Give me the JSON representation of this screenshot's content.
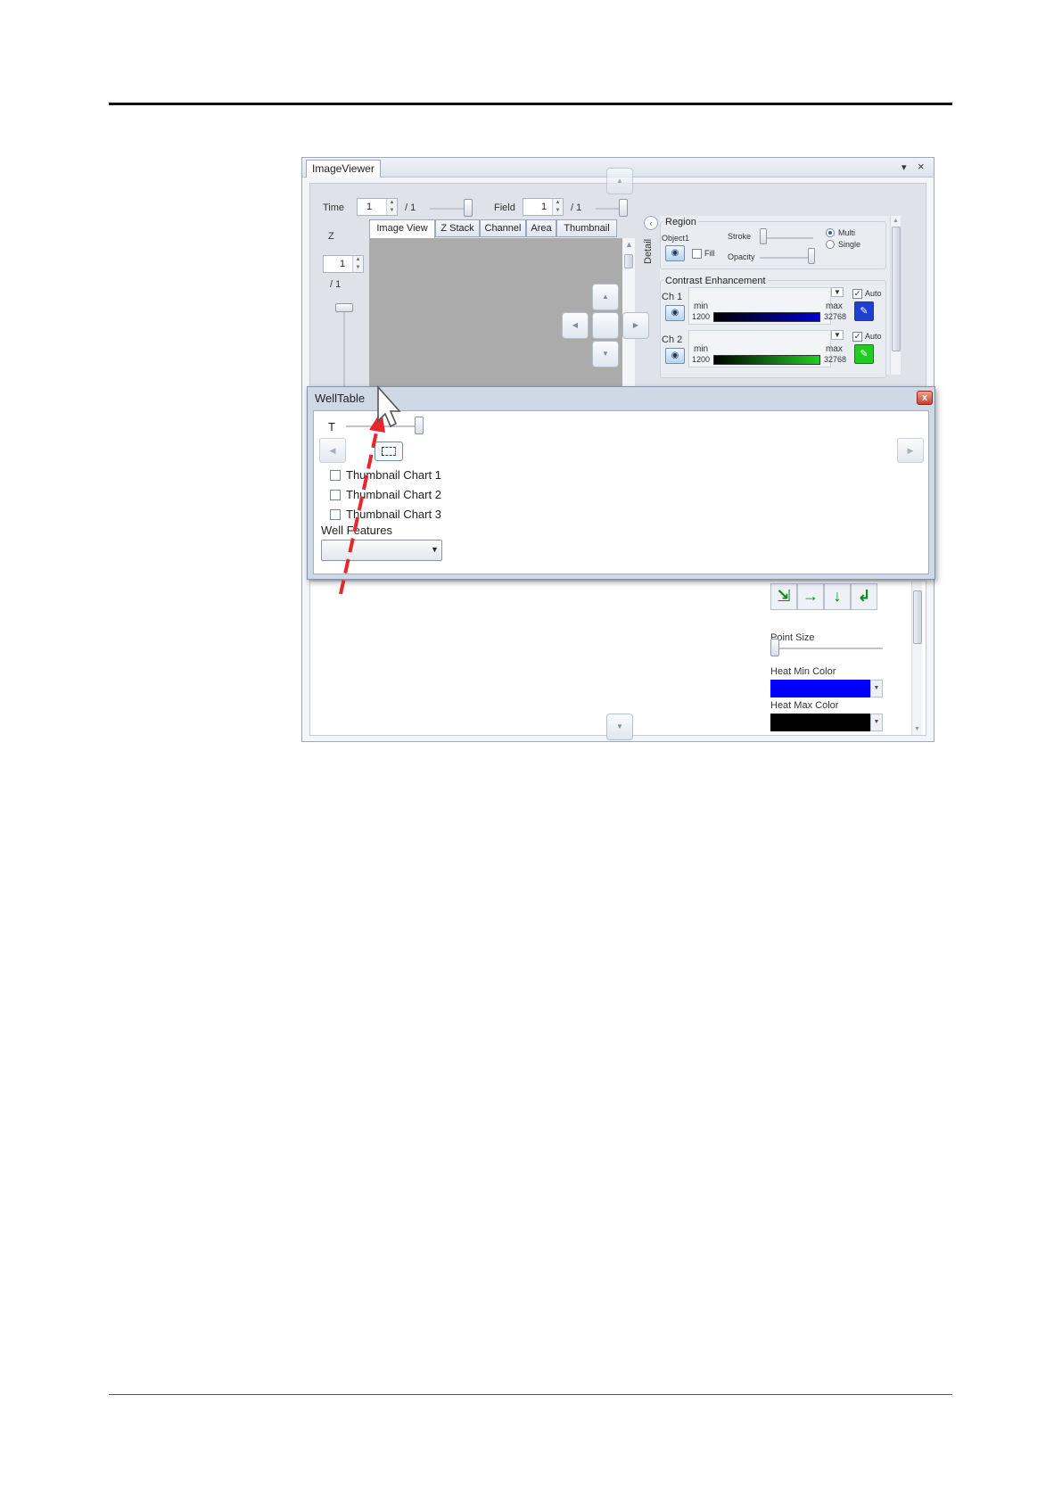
{
  "image_viewer": {
    "tab_title": "ImageViewer",
    "pin_icon": "▾",
    "close_icon": "×",
    "time_label": "Time",
    "time_value": "1",
    "time_total": "/ 1",
    "field_label": "Field",
    "field_value": "1",
    "field_total": "/ 1",
    "z_label": "Z",
    "z_value": "1",
    "z_total": "/ 1",
    "tabs": [
      "Image View",
      "Z Stack",
      "Channel",
      "Area",
      "Thumbnail"
    ],
    "detail_label": "Detail",
    "region": {
      "label": "Region",
      "object_label": "Object1",
      "fill_label": "Fill",
      "stroke_label": "Stroke",
      "opacity_label": "Opacity",
      "multi_label": "Multi",
      "single_label": "Single"
    },
    "contrast": {
      "label": "Contrast Enhancement",
      "channels": [
        {
          "name": "Ch 1",
          "min_label": "min",
          "max_label": "max",
          "min_value": "1200",
          "max_value": "32768",
          "auto_label": "Auto",
          "color": "#0000cc"
        },
        {
          "name": "Ch 2",
          "min_label": "min",
          "max_label": "max",
          "min_value": "1200",
          "max_value": "32768",
          "auto_label": "Auto",
          "color": "#22cc22"
        }
      ]
    },
    "point_size_label": "Point Size",
    "heat_min_label": "Heat Min Color",
    "heat_min_color": "#0000ff",
    "heat_max_label": "Heat Max Color",
    "heat_max_color": "#000000"
  },
  "well_table": {
    "title": "WellTable",
    "close_icon": "x",
    "t_label": "T",
    "checkboxes": [
      "Thumbnail Chart 1",
      "Thumbnail Chart 2",
      "Thumbnail Chart 3"
    ],
    "well_features_label": "Well Features",
    "well_features_value": ""
  },
  "annotation": {
    "arrow_color": "#e8262b"
  }
}
